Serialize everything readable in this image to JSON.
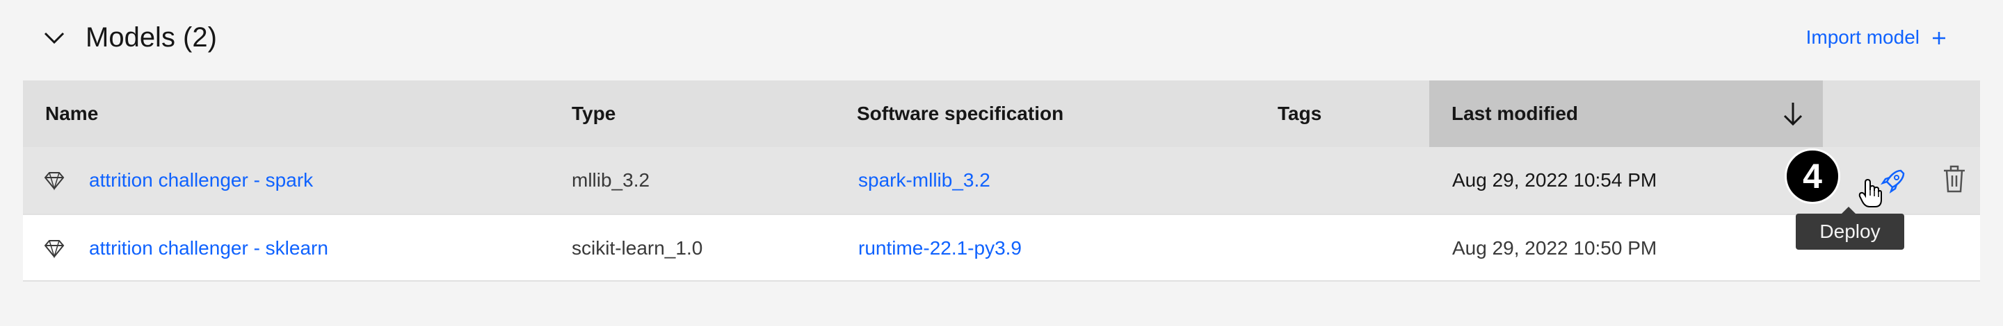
{
  "section": {
    "title": "Models (2)",
    "collapse_icon": "chevron-down-icon",
    "import_label": "Import model",
    "import_icon": "plus-icon"
  },
  "table": {
    "columns": {
      "name": "Name",
      "type": "Type",
      "software": "Software specification",
      "tags": "Tags",
      "last_modified": "Last modified"
    },
    "sort_icon": "arrow-down-icon",
    "rows": [
      {
        "name": "attrition challenger - spark",
        "type": "mllib_3.2",
        "software": "spark-mllib_3.2",
        "tags": "",
        "last_modified": "Aug 29, 2022 10:54 PM",
        "icon": "model-diamond-icon"
      },
      {
        "name": "attrition challenger - sklearn",
        "type": "scikit-learn_1.0",
        "software": "runtime-22.1-py3.9",
        "tags": "",
        "last_modified": "Aug 29, 2022 10:50 PM",
        "icon": "model-diamond-icon"
      }
    ],
    "row_actions": {
      "deploy_icon": "rocket-icon",
      "delete_icon": "trash-icon"
    }
  },
  "annotation": {
    "step_number": "4"
  },
  "tooltip": {
    "text": "Deploy"
  },
  "colors": {
    "link": "#0f62fe",
    "header_bg": "#e0e0e0",
    "sorted_header_bg": "#c6c6c6",
    "page_bg": "#f4f4f4",
    "hover_row_bg": "#e5e5e5"
  }
}
